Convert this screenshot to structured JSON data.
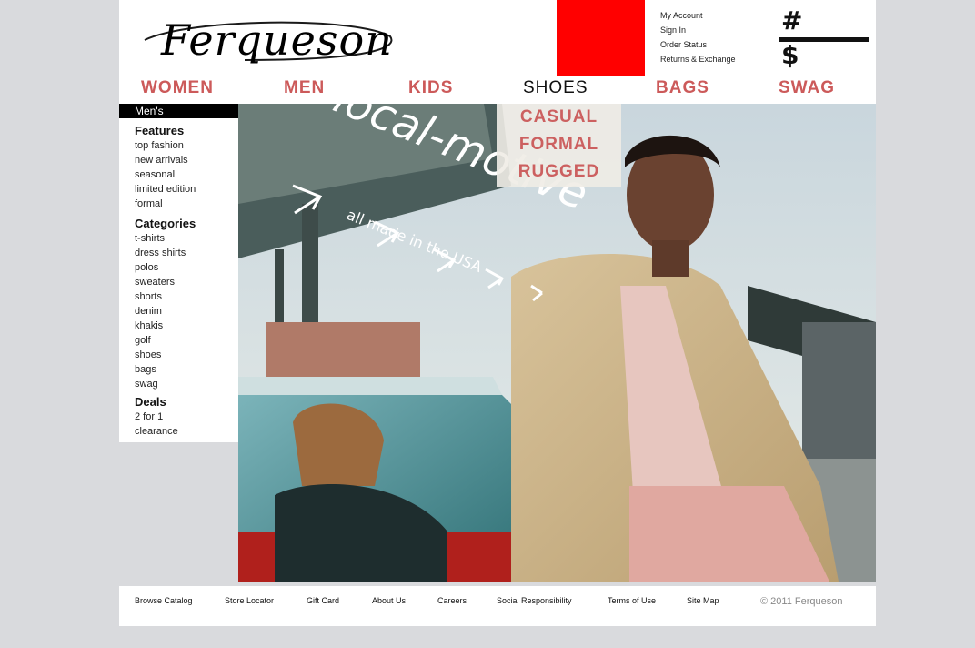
{
  "brand": {
    "logo_text": "Ferqueson"
  },
  "util_links": [
    "My Account",
    "Sign In",
    "Order Status",
    "Returns & Exchange"
  ],
  "cart": {
    "hash_symbol": "#",
    "dollar_symbol": "$"
  },
  "nav": [
    "WOMEN",
    "MEN",
    "KIDS",
    "SHOES",
    "BAGS",
    "SWAG"
  ],
  "shoes_menu": [
    "CASUAL",
    "FORMAL",
    "RUGGED"
  ],
  "sidebar": {
    "header": "Men's",
    "features_title": "Features",
    "features": [
      "top fashion",
      "new arrivals",
      "seasonal",
      "limited edition",
      "formal"
    ],
    "categories_title": "Categories",
    "categories": [
      "t-shirts",
      "dress shirts",
      "polos",
      "sweaters",
      "shorts",
      "denim",
      "khakis",
      "golf",
      "shoes",
      "bags",
      "swag"
    ],
    "deals_title": "Deals",
    "deals": [
      "2 for 1",
      "clearance"
    ]
  },
  "hero": {
    "headline": "local-motive",
    "subline": "all made in the USA"
  },
  "footer": {
    "links": [
      "Browse Catalog",
      "Store Locator",
      "Gift Card",
      "About Us",
      "Careers",
      "Social Responsibility",
      "Terms of Use",
      "Site Map"
    ],
    "copyright": "© 2011 Ferqueson"
  },
  "colors": {
    "accent_red": "#ff0000",
    "nav_red": "#cc5a5a",
    "background": "#d9dadd"
  }
}
